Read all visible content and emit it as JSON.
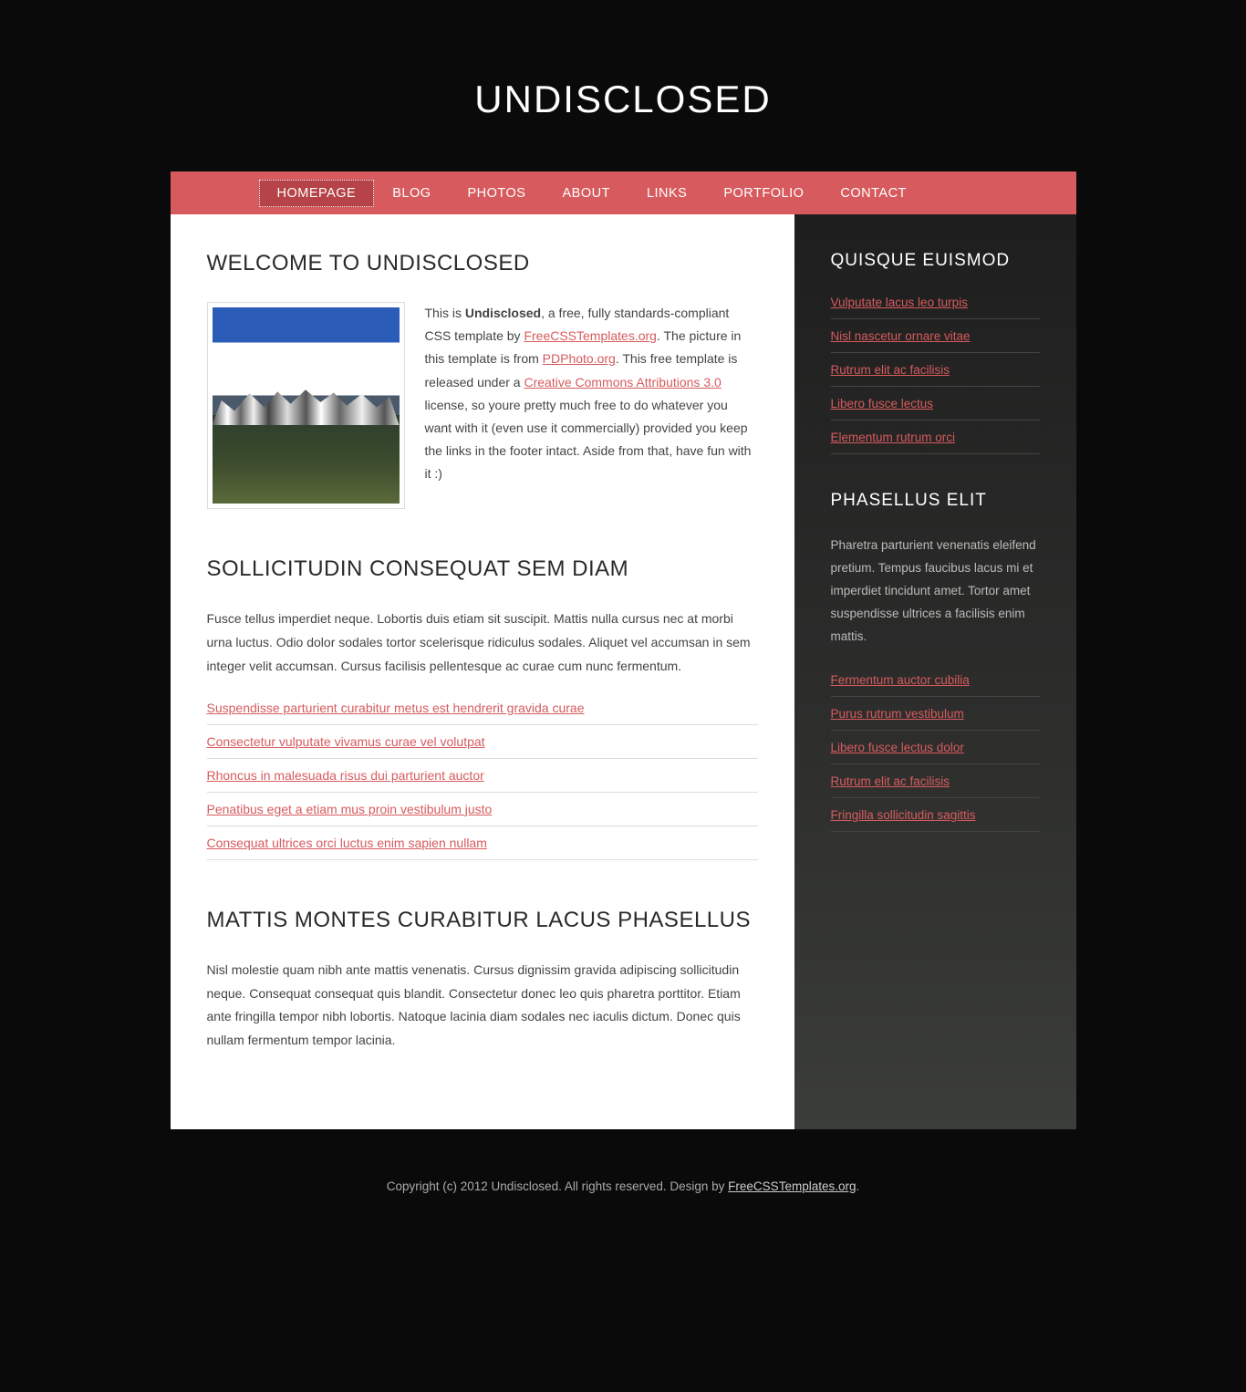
{
  "header": {
    "title": "UNDISCLOSED"
  },
  "nav": {
    "items": [
      {
        "label": "HOMEPAGE",
        "active": true
      },
      {
        "label": "BLOG",
        "active": false
      },
      {
        "label": "PHOTOS",
        "active": false
      },
      {
        "label": "ABOUT",
        "active": false
      },
      {
        "label": "LINKS",
        "active": false
      },
      {
        "label": "PORTFOLIO",
        "active": false
      },
      {
        "label": "CONTACT",
        "active": false
      }
    ]
  },
  "posts": {
    "intro": {
      "title": "WELCOME TO UNDISCLOSED",
      "t1": "This is ",
      "bold": "Undisclosed",
      "t2": ", a free, fully standards-compliant CSS template by ",
      "link1": "FreeCSSTemplates.org",
      "t3": ". The picture in this template is from ",
      "link2": "PDPhoto.org",
      "t4": ". This free template is released under a ",
      "link3": "Creative Commons Attributions 3.0",
      "t5": " license, so youre pretty much free to do whatever you want with it (even use it commercially) provided you keep the links in the footer intact. Aside from that, have fun with it :)"
    },
    "second": {
      "title": "SOLLICITUDIN CONSEQUAT SEM DIAM",
      "body": "Fusce tellus imperdiet neque. Lobortis duis etiam sit suscipit. Mattis nulla cursus nec at morbi urna luctus. Odio dolor sodales tortor scelerisque ridiculus sodales. Aliquet vel accumsan in sem integer velit accumsan. Cursus facilisis pellentesque ac curae cum nunc fermentum.",
      "links": [
        "Suspendisse parturient curabitur metus est hendrerit gravida curae",
        "Consectetur vulputate vivamus curae vel volutpat",
        "Rhoncus in malesuada risus dui parturient auctor",
        "Penatibus eget a etiam mus proin vestibulum justo",
        "Consequat ultrices orci luctus enim sapien nullam"
      ]
    },
    "third": {
      "title": "MATTIS MONTES CURABITUR LACUS PHASELLUS",
      "body": "Nisl molestie quam nibh ante mattis venenatis. Cursus dignissim gravida adipiscing sollicitudin neque. Consequat consequat quis blandit. Consectetur donec leo quis pharetra porttitor. Etiam ante fringilla tempor nibh lobortis. Natoque lacinia diam sodales nec iaculis dictum. Donec quis nullam fermentum tempor lacinia."
    }
  },
  "sidebar": {
    "block1": {
      "title": "QUISQUE EUISMOD",
      "links": [
        "Vulputate lacus leo turpis",
        "Nisl nascetur ornare vitae",
        "Rutrum elit ac facilisis",
        "Libero fusce lectus",
        "Elementum rutrum orci"
      ]
    },
    "block2": {
      "title": "PHASELLUS ELIT",
      "body": "Pharetra parturient venenatis eleifend pretium. Tempus faucibus lacus mi et imperdiet tincidunt amet. Tortor amet suspendisse ultrices a facilisis enim mattis.",
      "links": [
        "Fermentum auctor cubilia",
        "Purus rutrum vestibulum",
        "Libero fusce lectus dolor",
        "Rutrum elit ac facilisis",
        "Fringilla sollicitudin sagittis"
      ]
    }
  },
  "footer": {
    "t1": "Copyright (c) 2012 Undisclosed. All rights reserved. Design by ",
    "link": "FreeCSSTemplates.org",
    "t2": "."
  }
}
